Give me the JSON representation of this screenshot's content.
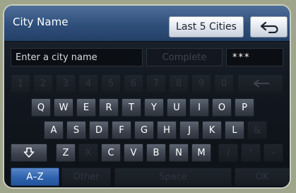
{
  "header": {
    "title": "City Name",
    "last5_label": "Last 5 Cities"
  },
  "input": {
    "placeholder": "Enter a city name",
    "complete_label": "Complete",
    "match_count": "***"
  },
  "keyboard": {
    "number_row": [
      "1",
      "2",
      "3",
      "4",
      "5",
      "6",
      "7",
      "8",
      "9",
      "0"
    ],
    "row1": [
      "Q",
      "W",
      "E",
      "R",
      "T",
      "Y",
      "U",
      "I",
      "O",
      "P"
    ],
    "row2": [
      "A",
      "S",
      "D",
      "F",
      "G",
      "H",
      "J",
      "K",
      "L",
      "&"
    ],
    "row3_letters": [
      "Z",
      "X",
      "C",
      "V",
      "B",
      "N",
      "M"
    ],
    "row3_symbols": [
      "/",
      "'",
      "-"
    ]
  },
  "bottom": {
    "az_label": "A–Z",
    "other_label": "Other",
    "space_label": "Space",
    "ok_label": "OK"
  },
  "colors": {
    "header_blue": "#2f4f7b",
    "active_blue": "#2f63ad",
    "key_gray": "#3b424d"
  }
}
